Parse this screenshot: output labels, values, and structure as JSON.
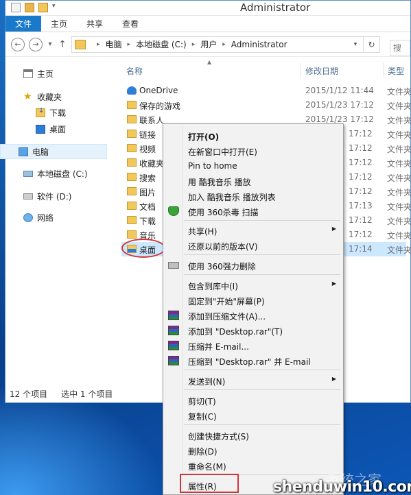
{
  "window": {
    "title": "Administrator"
  },
  "ribbon": {
    "tabs": [
      "文件",
      "主页",
      "共享",
      "查看"
    ]
  },
  "address": {
    "segments": [
      "电脑",
      "本地磁盘 (C:)",
      "用户",
      "Administrator"
    ]
  },
  "sidebar": {
    "items": [
      {
        "label": "主页",
        "icon": "home-icon"
      },
      {
        "label": "收藏夹",
        "icon": "star-icon"
      },
      {
        "label": "下载",
        "icon": "downloads-folder-icon"
      },
      {
        "label": "桌面",
        "icon": "desktop-icon"
      },
      {
        "label": "电脑",
        "icon": "computer-icon",
        "selected": true
      },
      {
        "label": "本地磁盘 (C:)",
        "icon": "drive-icon"
      },
      {
        "label": "软件 (D:)",
        "icon": "drive-icon"
      },
      {
        "label": "网络",
        "icon": "network-icon"
      }
    ]
  },
  "columns": {
    "name": "名称",
    "date": "修改日期",
    "type": "类型"
  },
  "files": [
    {
      "name": "OneDrive",
      "date": "2015/1/12 11:44",
      "type": "文件夹",
      "icon": "onedrive-icon"
    },
    {
      "name": "保存的游戏",
      "date": "2015/1/23 17:12",
      "type": "文件夹",
      "icon": "folder-icon"
    },
    {
      "name": "联系人",
      "date": "2015/1/23 17:12",
      "type": "文件夹",
      "icon": "folder-icon"
    },
    {
      "name": "链接",
      "date": "17:12",
      "type": "文件夹",
      "icon": "folder-icon"
    },
    {
      "name": "视频",
      "date": "17:12",
      "type": "文件夹",
      "icon": "folder-icon"
    },
    {
      "name": "收藏夹",
      "date": "17:12",
      "type": "文件夹",
      "icon": "folder-icon"
    },
    {
      "name": "搜索",
      "date": "17:12",
      "type": "文件夹",
      "icon": "folder-icon"
    },
    {
      "name": "图片",
      "date": "17:12",
      "type": "文件夹",
      "icon": "folder-icon"
    },
    {
      "name": "文档",
      "date": "17:13",
      "type": "文件夹",
      "icon": "folder-icon"
    },
    {
      "name": "下载",
      "date": "17:12",
      "type": "文件夹",
      "icon": "folder-icon"
    },
    {
      "name": "音乐",
      "date": "17:12",
      "type": "文件夹",
      "icon": "folder-icon"
    },
    {
      "name": "桌面",
      "date": "17:14",
      "type": "文件夹",
      "icon": "desktop-folder-icon",
      "selected": true
    }
  ],
  "status": {
    "count": "12 个项目",
    "selection": "选中 1 个项目"
  },
  "context_menu": [
    {
      "label": "打开(O)",
      "bold": true
    },
    {
      "label": "在新窗口中打开(E)"
    },
    {
      "label": "Pin to home"
    },
    {
      "label": "用 酷我音乐 播放"
    },
    {
      "label": "加入 酷我音乐 播放列表"
    },
    {
      "label": "使用 360杀毒 扫描",
      "icon": "shield-icon"
    },
    {
      "label": "共享(H)",
      "submenu": true
    },
    {
      "label": "还原以前的版本(V)"
    },
    {
      "label": "使用 360强力删除",
      "icon": "shredder-icon"
    },
    {
      "label": "包含到库中(I)",
      "submenu": true
    },
    {
      "label": "固定到\"开始\"屏幕(P)"
    },
    {
      "label": "添加到压缩文件(A)...",
      "icon": "winrar-icon"
    },
    {
      "label": "添加到 \"Desktop.rar\"(T)",
      "icon": "winrar-icon"
    },
    {
      "label": "压缩并 E-mail...",
      "icon": "winrar-icon"
    },
    {
      "label": "压缩到 \"Desktop.rar\" 并 E-mail",
      "icon": "winrar-icon"
    },
    {
      "label": "发送到(N)",
      "submenu": true
    },
    {
      "label": "剪切(T)"
    },
    {
      "label": "复制(C)"
    },
    {
      "label": "创建快捷方式(S)"
    },
    {
      "label": "删除(D)"
    },
    {
      "label": "重命名(M)"
    },
    {
      "label": "属性(R)"
    }
  ],
  "watermark": {
    "text": "shenduwin10.com"
  }
}
